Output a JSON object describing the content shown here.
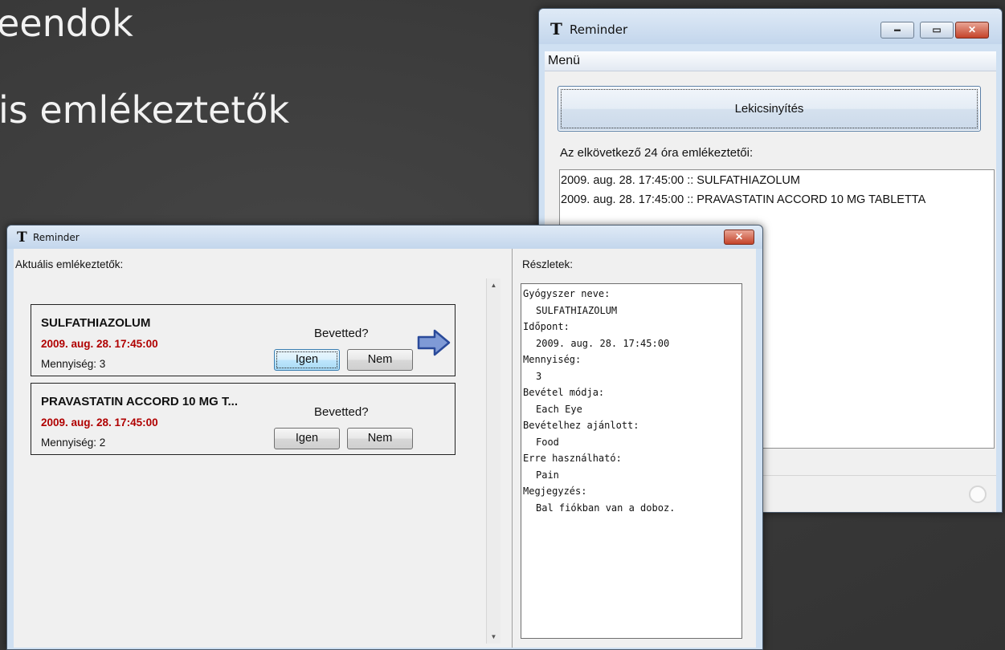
{
  "slide": {
    "line1": "eendok",
    "line2": "is emlékeztetők"
  },
  "back_window": {
    "title": "Reminder",
    "app_icon_glyph": "T",
    "menu_label": "Menü",
    "minimize_glyph": "▬",
    "maximize_glyph": "▭",
    "close_glyph": "✕",
    "collapse_button": "Lekicsinyítés",
    "upcoming_label": "Az elkövetkező 24 óra emlékeztetői:",
    "upcoming_items": [
      "2009. aug. 28. 17:45:00 :: SULFATHIAZOLUM",
      "2009. aug. 28. 17:45:00 :: PRAVASTATIN ACCORD 10 MG TABLETTA"
    ]
  },
  "front_window": {
    "title": "Reminder",
    "app_icon_glyph": "T",
    "close_glyph": "✕",
    "current_label": "Aktuális emlékeztetők:",
    "details_label": "Részletek:",
    "reminders": [
      {
        "name": "SULFATHIAZOLUM",
        "time": "2009. aug. 28. 17:45:00",
        "quantity": "Mennyiség: 3",
        "question": "Bevetted?",
        "yes": "Igen",
        "no": "Nem"
      },
      {
        "name": "PRAVASTATIN ACCORD 10 MG T...",
        "time": "2009. aug. 28. 17:45:00",
        "quantity": "Mennyiség: 2",
        "question": "Bevetted?",
        "yes": "Igen",
        "no": "Nem"
      }
    ],
    "details": [
      {
        "key": "Gyógyszer neve:",
        "value": "SULFATHIAZOLUM"
      },
      {
        "key": "Időpont:",
        "value": "2009. aug. 28. 17:45:00"
      },
      {
        "key": "Mennyiség:",
        "value": "3"
      },
      {
        "key": "Bevétel módja:",
        "value": "Each Eye"
      },
      {
        "key": "Bevételhez ajánlott:",
        "value": "Food"
      },
      {
        "key": "Erre használható:",
        "value": "Pain"
      },
      {
        "key": "Megjegyzés:",
        "value": "Bal fiókban van a doboz."
      }
    ]
  },
  "colors": {
    "reminder_time": "#b00000",
    "arrow_fill": "#7f9ad6",
    "arrow_stroke": "#2a4a9a"
  },
  "icons": {
    "arrow": "right-arrow-icon",
    "scroll_up": "scroll-up-arrow-icon",
    "scroll_down": "scroll-down-arrow-icon",
    "status": "status-circle-icon"
  }
}
